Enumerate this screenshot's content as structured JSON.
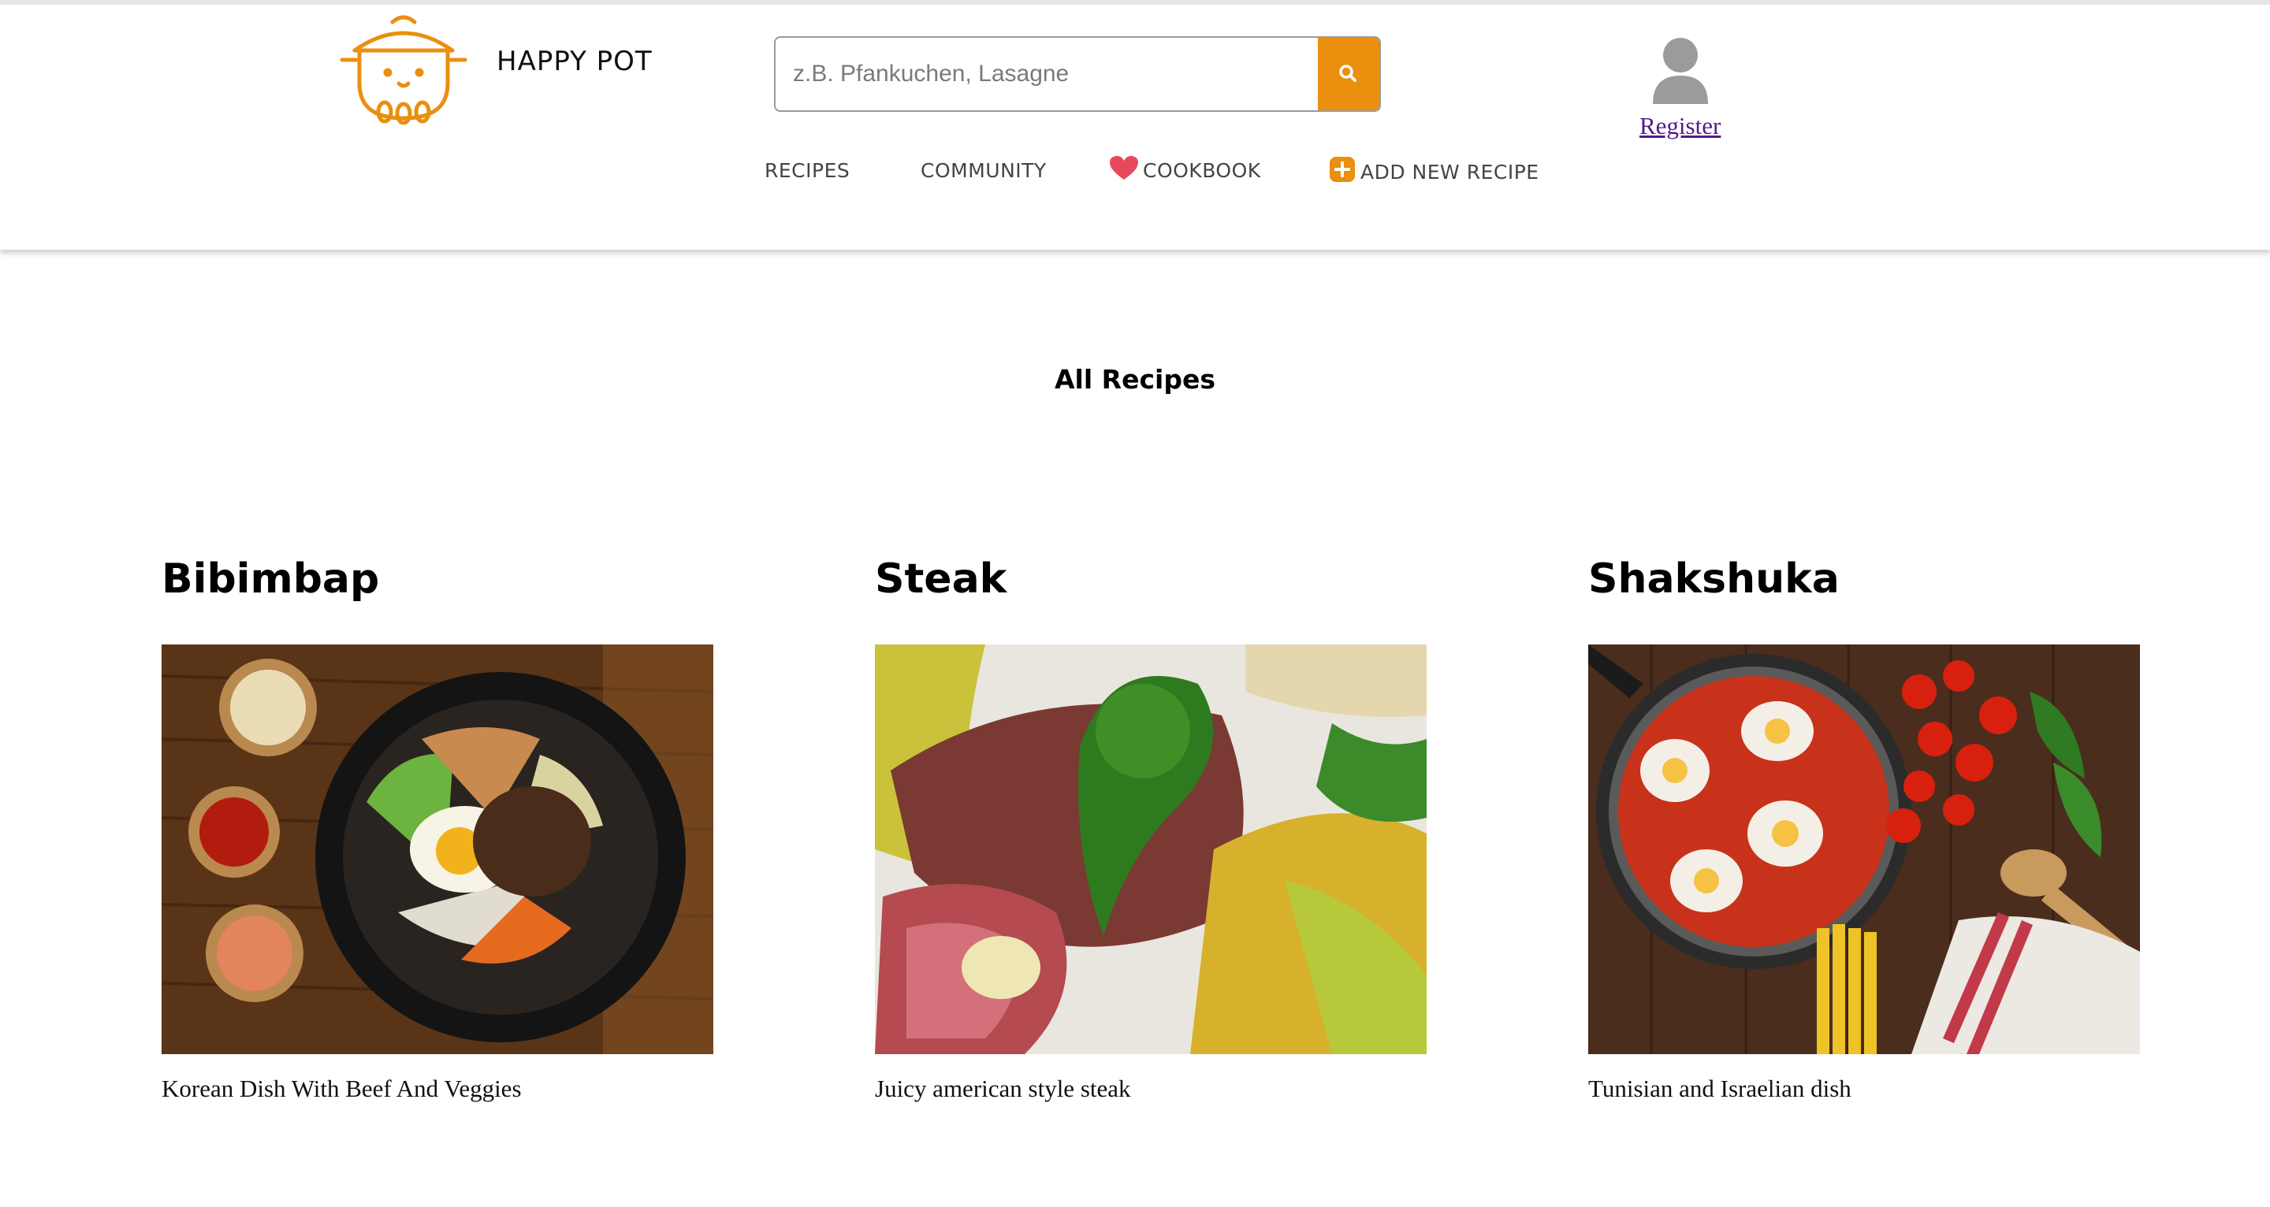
{
  "brand": {
    "name": "HAPPY POT",
    "logo_icon": "cooking-pot-icon",
    "color": "#ea8f0e"
  },
  "search": {
    "placeholder": "z.B. Pfankuchen, Lasagne",
    "value": "",
    "button_icon": "search-icon"
  },
  "nav": {
    "recipes": "RECIPES",
    "community": "COMMUNITY",
    "cookbook": "COOKBOOK",
    "cookbook_icon": "heart-icon",
    "add_recipe": "ADD NEW RECIPE",
    "add_recipe_icon": "plus-icon"
  },
  "user": {
    "icon": "user-avatar-icon",
    "register_label": "Register"
  },
  "main": {
    "title": "All Recipes",
    "recipes": [
      {
        "title": "Bibimbap",
        "description": "Korean Dish With Beef And Veggies",
        "image": "bibimbap-photo"
      },
      {
        "title": "Steak",
        "description": "Juicy american style steak",
        "image": "steak-photo"
      },
      {
        "title": "Shakshuka",
        "description": "Tunisian and Israelian dish",
        "image": "shakshuka-photo"
      }
    ]
  },
  "colors": {
    "accent": "#ea8f0e",
    "heart": "#e8485e",
    "link_visited": "#551a8b"
  }
}
